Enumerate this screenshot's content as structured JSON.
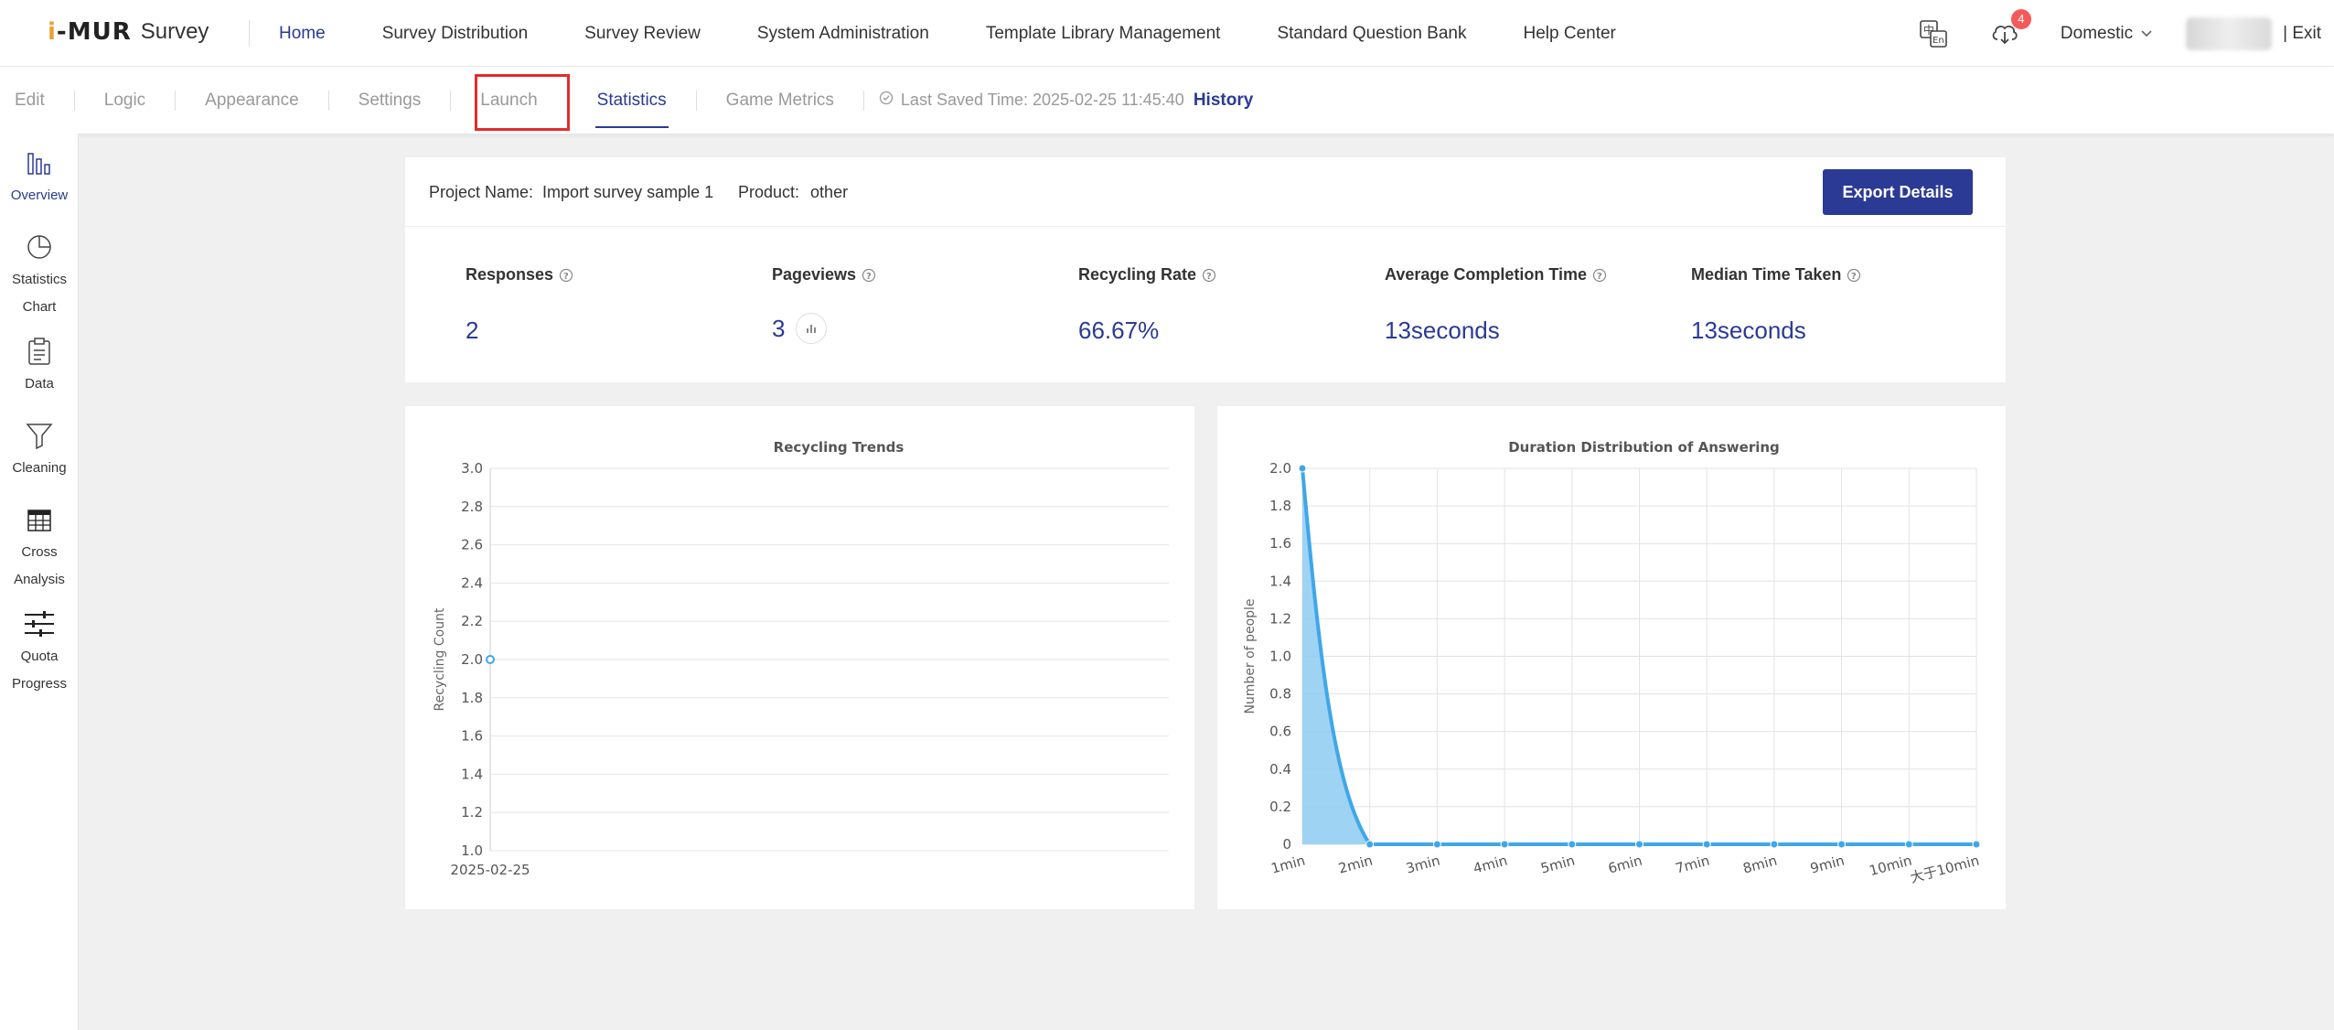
{
  "header": {
    "logo_text": "Survey",
    "nav": [
      "Home",
      "Survey Distribution",
      "Survey Review",
      "System Administration",
      "Template Library Management",
      "Standard Question Bank",
      "Help Center"
    ],
    "notification_count": "4",
    "region": "Domestic",
    "exit": "| Exit"
  },
  "subnav": {
    "tabs": [
      "Edit",
      "Logic",
      "Appearance",
      "Settings",
      "Launch",
      "Statistics",
      "Game Metrics"
    ],
    "active_tab": "Statistics",
    "saved_text": "Last Saved Time: 2025-02-25 11:45:40",
    "history": "History"
  },
  "sidebar": {
    "items": [
      {
        "label1": "Overview",
        "label2": "",
        "icon": "bar-chart-icon"
      },
      {
        "label1": "Statistics",
        "label2": "Chart",
        "icon": "pie-chart-icon"
      },
      {
        "label1": "Data",
        "label2": "",
        "icon": "clipboard-icon"
      },
      {
        "label1": "Cleaning",
        "label2": "",
        "icon": "filter-icon"
      },
      {
        "label1": "Cross",
        "label2": "Analysis",
        "icon": "table-icon"
      },
      {
        "label1": "Quota",
        "label2": "Progress",
        "icon": "sliders-icon"
      }
    ]
  },
  "project": {
    "name_label": "Project Name:",
    "name": "Import survey sample 1",
    "product_label": "Product:",
    "product": "other",
    "export_button": "Export Details"
  },
  "metrics": [
    {
      "label": "Responses",
      "value": "2"
    },
    {
      "label": "Pageviews",
      "value": "3"
    },
    {
      "label": "Recycling Rate",
      "value": "66.67%"
    },
    {
      "label": "Average Completion Time",
      "value": "13seconds"
    },
    {
      "label": "Median Time Taken",
      "value": "13seconds"
    }
  ],
  "colors": {
    "accent": "#2b3a94",
    "chart_line": "#3fa7e8",
    "chart_fill": "#8ecbf2",
    "highlight": "#e52a2a",
    "badge": "#f5595a"
  },
  "chart_data": [
    {
      "type": "line",
      "title": "Recycling Trends",
      "xlabel": "",
      "ylabel": "Recycling Count",
      "categories": [
        "2025-02-25"
      ],
      "values": [
        2.0
      ],
      "ylim": [
        1.0,
        3.0
      ],
      "yticks": [
        "3.0",
        "2.8",
        "2.6",
        "2.4",
        "2.2",
        "2.0",
        "1.8",
        "1.6",
        "1.4",
        "1.2",
        "1.0"
      ],
      "grid": "horizontal"
    },
    {
      "type": "area",
      "title": "Duration Distribution of Answering",
      "xlabel": "",
      "ylabel": "Number of people",
      "categories": [
        "1min",
        "2min",
        "3min",
        "4min",
        "5min",
        "6min",
        "7min",
        "8min",
        "9min",
        "10min",
        "大于10min"
      ],
      "values": [
        2,
        0,
        0,
        0,
        0,
        0,
        0,
        0,
        0,
        0,
        0
      ],
      "ylim": [
        0,
        2.0
      ],
      "yticks": [
        "2.0",
        "1.8",
        "1.6",
        "1.4",
        "1.2",
        "1.0",
        "0.8",
        "0.6",
        "0.4",
        "0.2",
        "0"
      ],
      "grid": "both"
    }
  ]
}
